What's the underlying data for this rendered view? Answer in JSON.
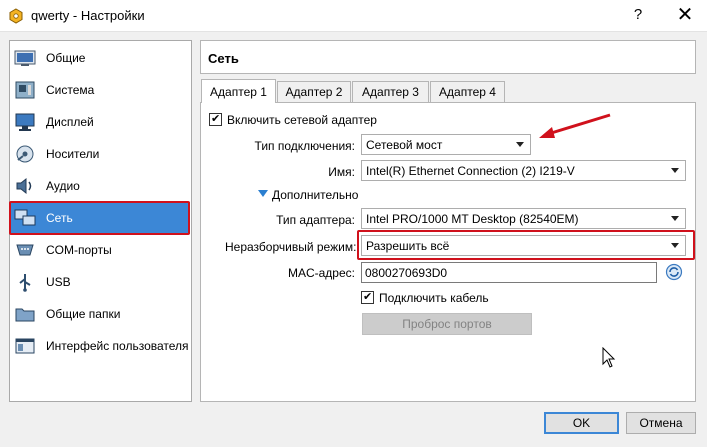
{
  "window": {
    "title": "qwerty - Настройки",
    "help_glyph": "?",
    "close_glyph": "✕"
  },
  "sidebar": {
    "items": [
      {
        "label": "Общие",
        "icon": "general-settings-icon"
      },
      {
        "label": "Система",
        "icon": "motherboard-icon"
      },
      {
        "label": "Дисплей",
        "icon": "monitor-icon"
      },
      {
        "label": "Носители",
        "icon": "disc-storage-icon"
      },
      {
        "label": "Аудио",
        "icon": "speaker-icon"
      },
      {
        "label": "Сеть",
        "icon": "network-icon"
      },
      {
        "label": "COM-порты",
        "icon": "serial-port-icon"
      },
      {
        "label": "USB",
        "icon": "usb-icon"
      },
      {
        "label": "Общие папки",
        "icon": "shared-folder-icon"
      },
      {
        "label": "Интерфейс пользователя",
        "icon": "user-interface-icon"
      }
    ],
    "selected": "Сеть"
  },
  "main": {
    "title": "Сеть",
    "tabs": [
      {
        "label": "Адаптер 1",
        "active": true
      },
      {
        "label": "Адаптер 2",
        "active": false
      },
      {
        "label": "Адаптер 3",
        "active": false
      },
      {
        "label": "Адаптер 4",
        "active": false
      }
    ],
    "enable_adapter": {
      "label": "Включить сетевой адаптер",
      "checked": true
    },
    "attached_to": {
      "label": "Тип подключения:",
      "value": "Сетевой мост"
    },
    "name": {
      "label": "Имя:",
      "value": "Intel(R) Ethernet Connection (2) I219-V"
    },
    "advanced": {
      "label": "Дополнительно"
    },
    "adapter_type": {
      "label": "Тип адаптера:",
      "value": "Intel PRO/1000 MT Desktop (82540EM)"
    },
    "promiscuous": {
      "label": "Неразборчивый режим:",
      "value": "Разрешить всё"
    },
    "mac": {
      "label": "MAC-адрес:",
      "value": "0800270693D0"
    },
    "cable": {
      "label": "Подключить кабель",
      "checked": true
    },
    "port_forwarding": {
      "label": "Проброс портов"
    }
  },
  "footer": {
    "ok": "OK",
    "cancel": "Отмена"
  },
  "colors": {
    "selection": "#3c87d6",
    "annotation_red": "#d0111c"
  }
}
